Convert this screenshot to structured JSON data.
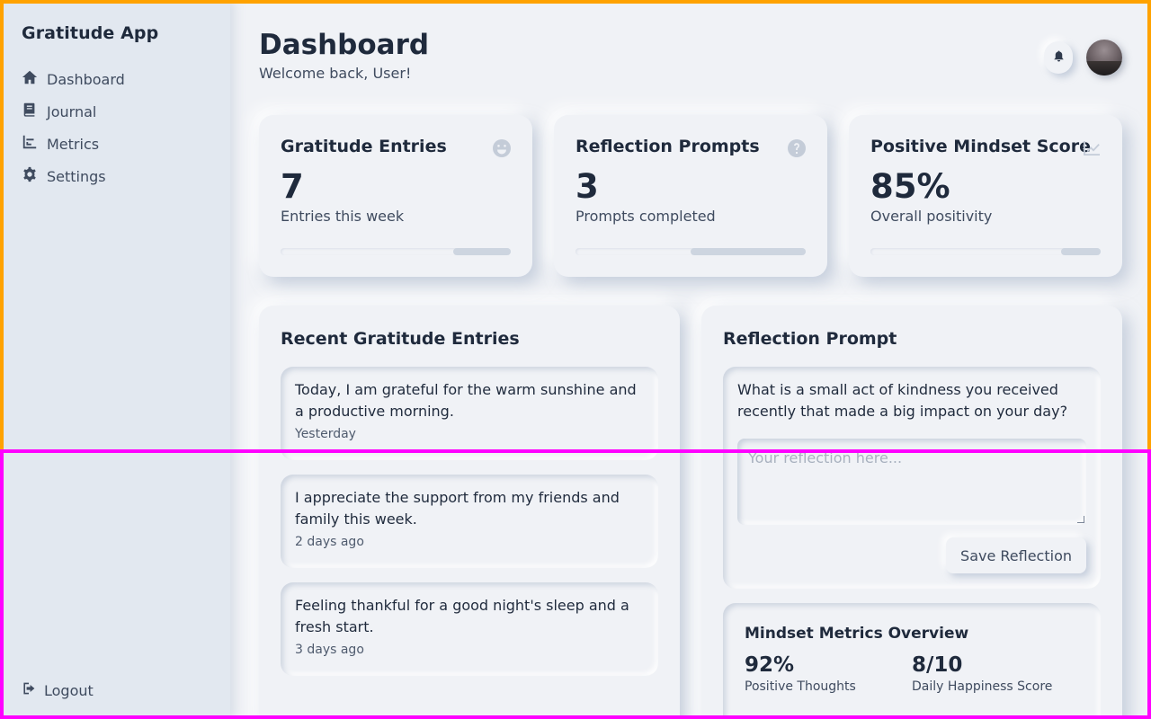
{
  "app": {
    "name": "Gratitude App"
  },
  "nav": {
    "items": [
      {
        "label": "Dashboard",
        "icon": "home-icon"
      },
      {
        "label": "Journal",
        "icon": "book-icon"
      },
      {
        "label": "Metrics",
        "icon": "chart-icon"
      },
      {
        "label": "Settings",
        "icon": "gear-icon"
      }
    ],
    "logout": "Logout"
  },
  "header": {
    "title": "Dashboard",
    "subtitle": "Welcome back, User!"
  },
  "stats": [
    {
      "title": "Gratitude Entries",
      "value": "7",
      "label": "Entries this week",
      "icon": "smile-icon",
      "progress": 0.0
    },
    {
      "title": "Reflection Prompts",
      "value": "3",
      "label": "Prompts completed",
      "icon": "question-icon",
      "progress": 0.0
    },
    {
      "title": "Positive Mindset Score",
      "value": "85%",
      "label": "Overall positivity",
      "icon": "trend-chart-icon",
      "progress": 0.85
    }
  ],
  "recent": {
    "title": "Recent Gratitude Entries",
    "entries": [
      {
        "text": "Today, I am grateful for the warm sunshine and a productive morning.",
        "time": "Yesterday"
      },
      {
        "text": "I appreciate the support from my friends and family this week.",
        "time": "2 days ago"
      },
      {
        "text": "Feeling thankful for a good night's sleep and a fresh start.",
        "time": "3 days ago"
      }
    ]
  },
  "reflection": {
    "title": "Reflection Prompt",
    "prompt": "What is a small act of kindness you received recently that made a big impact on your day?",
    "placeholder": "Your reflection here...",
    "save_label": "Save Reflection"
  },
  "metrics": {
    "title": "Mindset Metrics Overview",
    "items": [
      {
        "value": "92%",
        "label": "Positive Thoughts"
      },
      {
        "value": "8/10",
        "label": "Daily Happiness Score"
      }
    ]
  },
  "colors": {
    "background": "#f0f2f6",
    "sidebar": "#e2e8f0",
    "text": "#1f2a3c",
    "muted": "#3f4b5f",
    "progress_rest": "#cdd5e0"
  }
}
